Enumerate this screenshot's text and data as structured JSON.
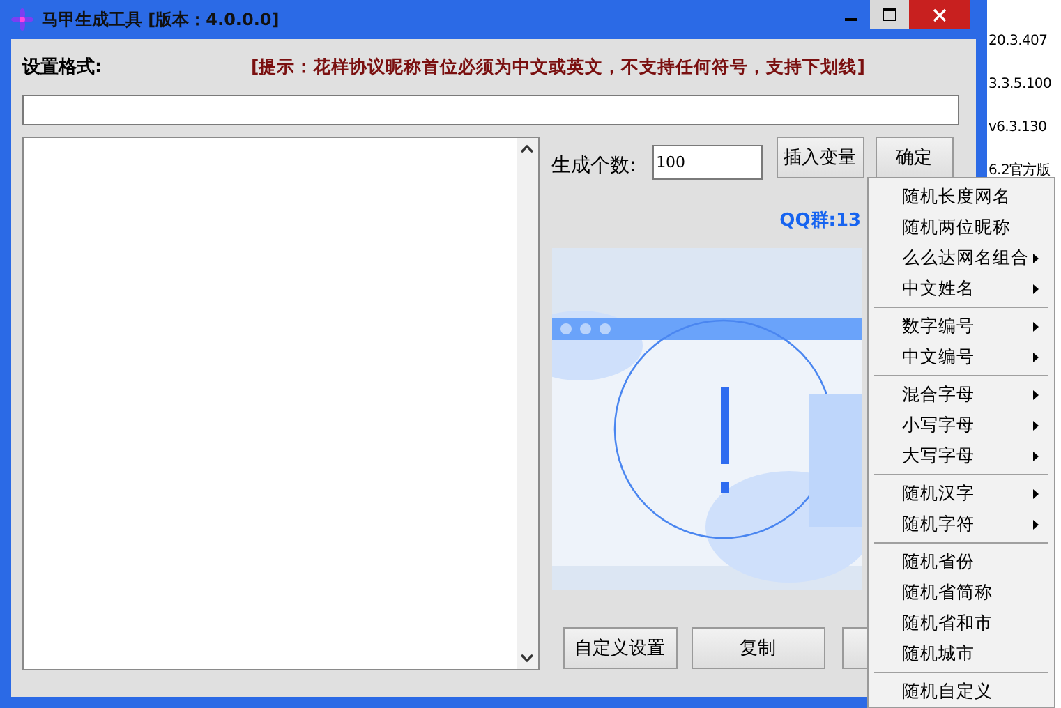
{
  "window": {
    "title": "马甲生成工具 [版本：4.0.0.0]"
  },
  "format": {
    "label": "设置格式:",
    "hint": "[提示：花样协议昵称首位必须为中文或英文，不支持任何符号，支持下划线]"
  },
  "count": {
    "label": "生成个数:",
    "value": "100"
  },
  "buttons": [
    "插入变量",
    "确定"
  ],
  "qq": "QQ群:13",
  "bottom_buttons": [
    "自定义设置",
    "复制"
  ],
  "context_menu": {
    "groups": [
      [
        {
          "label": "随机长度网名",
          "has_submenu": false
        },
        {
          "label": "随机两位昵称",
          "has_submenu": false
        },
        {
          "label": "么么达网名组合",
          "has_submenu": true
        },
        {
          "label": "中文姓名",
          "has_submenu": true
        }
      ],
      [
        {
          "label": "数字编号",
          "has_submenu": true
        },
        {
          "label": "中文编号",
          "has_submenu": true
        }
      ],
      [
        {
          "label": "混合字母",
          "has_submenu": true
        },
        {
          "label": "小写字母",
          "has_submenu": true
        },
        {
          "label": "大写字母",
          "has_submenu": true
        }
      ],
      [
        {
          "label": "随机汉字",
          "has_submenu": true
        },
        {
          "label": "随机字符",
          "has_submenu": true
        }
      ],
      [
        {
          "label": "随机省份",
          "has_submenu": false
        },
        {
          "label": "随机省简称",
          "has_submenu": false
        },
        {
          "label": "随机省和市",
          "has_submenu": false
        },
        {
          "label": "随机城市",
          "has_submenu": false
        }
      ],
      [
        {
          "label": "随机自定义",
          "has_submenu": false
        }
      ]
    ]
  },
  "background_list": [
    "20.3.407",
    "3.3.5.100",
    "v6.3.130",
    "6.2官方版"
  ]
}
